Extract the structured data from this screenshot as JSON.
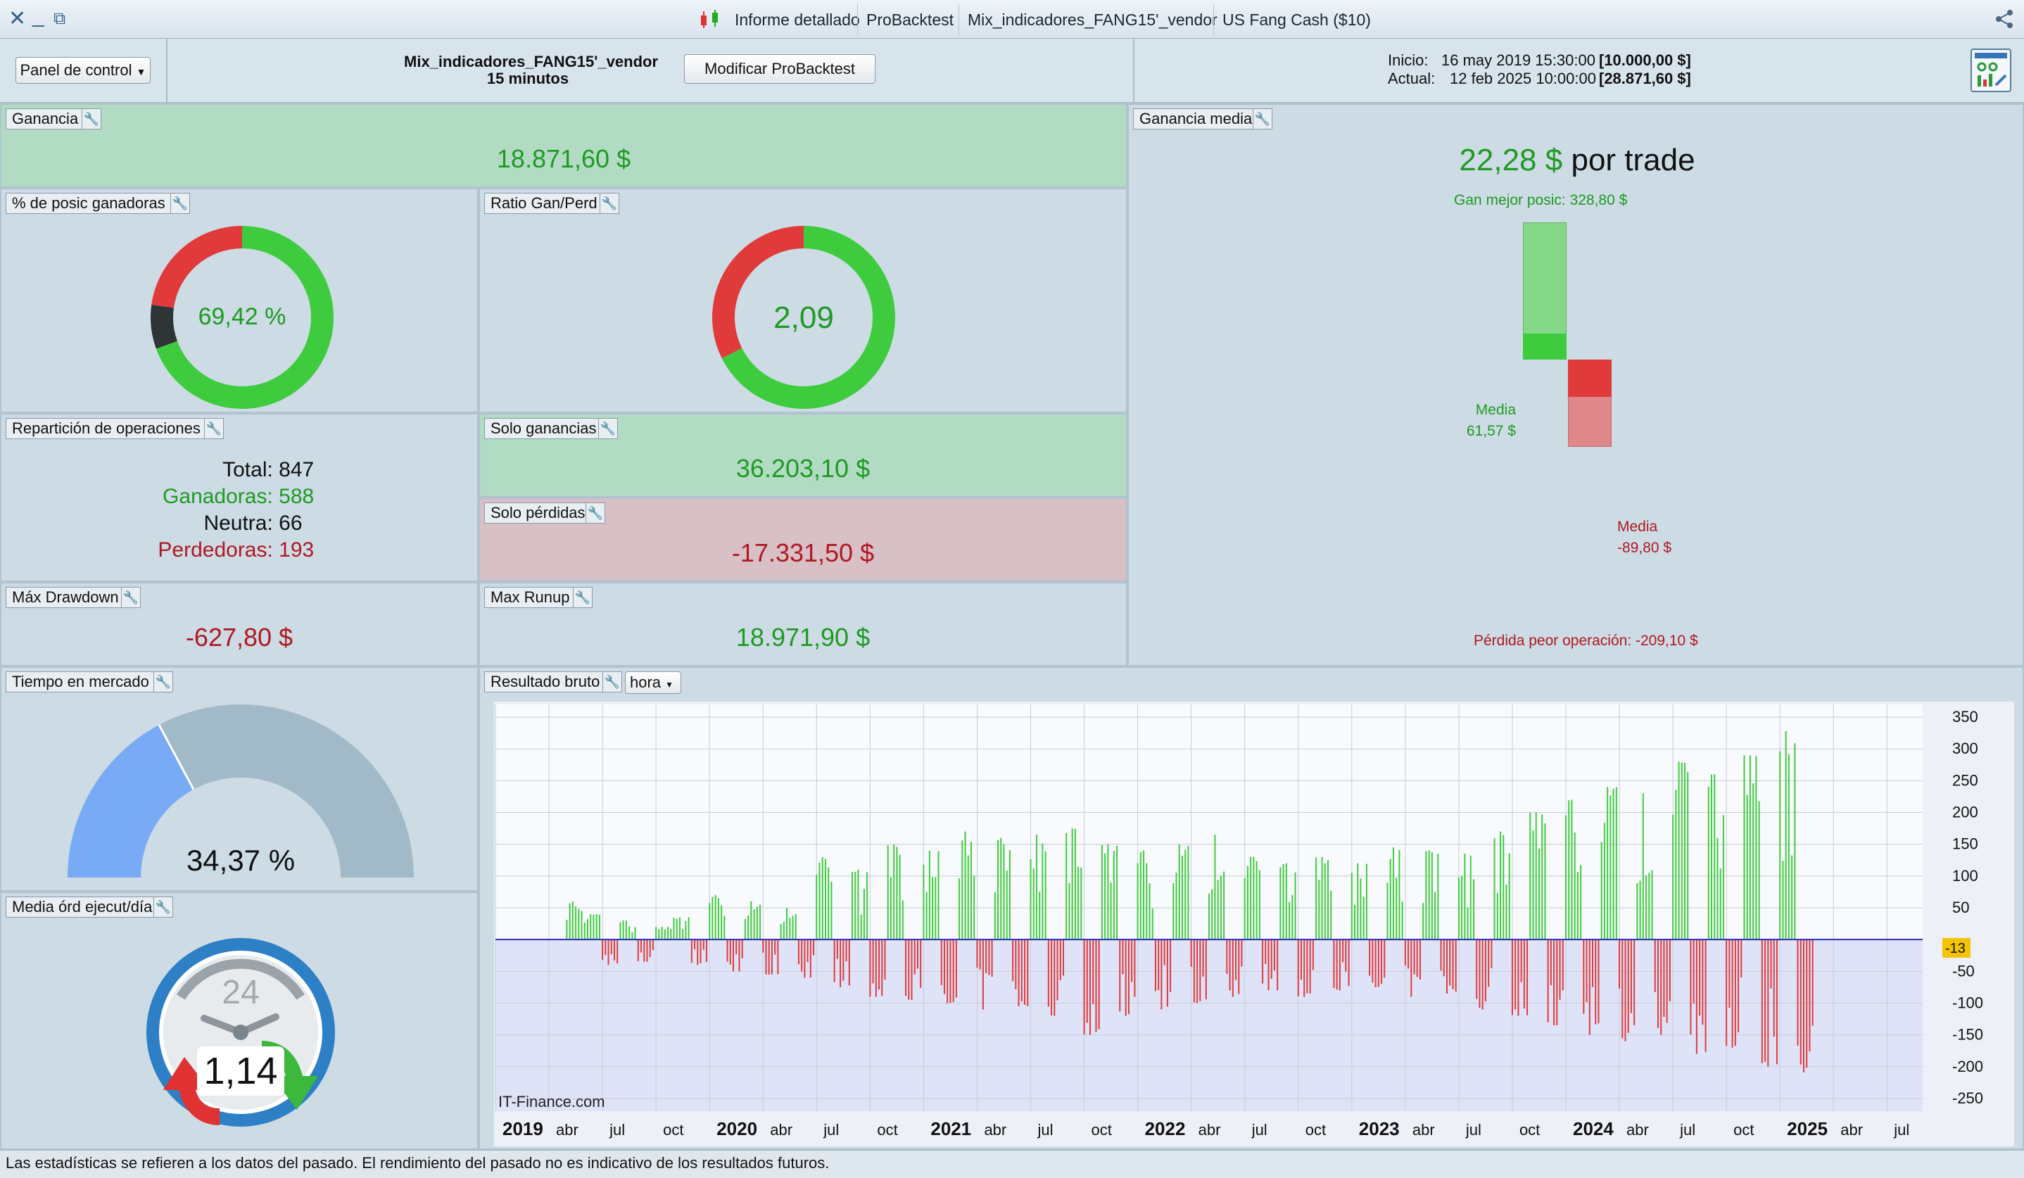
{
  "titlebar": {
    "tabs": [
      "Informe detallado",
      "ProBacktest",
      "Mix_indicadores_FANG15'_vendor",
      "US Fang Cash ($10)"
    ],
    "close_icon": "close-icon",
    "minimize_icon": "minimize-icon",
    "restore_icon": "restore-icon",
    "share_icon": "share-icon"
  },
  "header": {
    "panel_menu_label": "Panel de control",
    "strategy_name": "Mix_indicadores_FANG15'_vendor",
    "timeframe": "15 minutos",
    "modify_button": "Modificar ProBacktest",
    "start_label": "Inicio:",
    "start_date": "16 may 2019 15:30:00",
    "start_value": "[10.000,00 $]",
    "current_label": "Actual:",
    "current_date": "12 feb 2025 10:00:00",
    "current_value": "[28.871,60 $]"
  },
  "ganancia": {
    "label": "Ganancia",
    "value": "18.871,60 $"
  },
  "winners_pct": {
    "label": "% de posic ganadoras",
    "value": "69,42 %",
    "win": 588,
    "neutral": 66,
    "lose": 193
  },
  "ratio": {
    "label": "Ratio Gan/Perd",
    "value": "2,09",
    "gain": 36203.1,
    "loss": 17331.5
  },
  "reparticion": {
    "label": "Repartición de operaciones",
    "total_label": "Total:",
    "total": "847",
    "win_label": "Ganadoras:",
    "win": "588",
    "neutral_label": "Neutra:",
    "neutral": "66",
    "lose_label": "Perdedoras:",
    "lose": "193"
  },
  "solo_ganancias": {
    "label": "Solo ganancias",
    "value": "36.203,10 $"
  },
  "solo_perdidas": {
    "label": "Solo pérdidas",
    "value": "-17.331,50 $"
  },
  "max_drawdown": {
    "label": "Máx Drawdown",
    "value": "-627,80 $"
  },
  "max_runup": {
    "label": "Max Runup",
    "value": "18.971,90 $"
  },
  "ganancia_media": {
    "label": "Ganancia media",
    "value": "22,28 $",
    "suffix": "por trade",
    "best_label": "Gan mejor posic: 328,80 $",
    "best": 328.8,
    "avg_win_label": "Media",
    "avg_win_value": "61,57 $",
    "avg_win": 61.57,
    "avg_loss_label": "Media",
    "avg_loss_value": "-89,80 $",
    "avg_loss": -89.8,
    "worst_label": "Pérdida peor operación: -209,10 $",
    "worst": -209.1
  },
  "tiempo_mercado": {
    "label": "Tiempo en mercado",
    "value": "34,37 %",
    "fraction": 0.3437
  },
  "media_ord": {
    "label": "Media órd ejecut/día",
    "value": "1,14",
    "clock_text": "24"
  },
  "resultado_bruto": {
    "label": "Resultado bruto",
    "dropdown": "hora",
    "watermark": "IT-Finance.com",
    "last_value_label": "-13"
  },
  "chart_data": {
    "type": "bar",
    "title": "",
    "ylim": [
      -270,
      370
    ],
    "y_ticks": [
      350,
      300,
      250,
      200,
      150,
      100,
      50,
      -50,
      -100,
      -150,
      -200,
      -250
    ],
    "x_ticks": [
      {
        "label": "2019",
        "bold": true,
        "date": "2019-01"
      },
      {
        "label": "abr",
        "bold": false,
        "date": "2019-04"
      },
      {
        "label": "jul",
        "bold": false,
        "date": "2019-07"
      },
      {
        "label": "oct",
        "bold": false,
        "date": "2019-10"
      },
      {
        "label": "2020",
        "bold": true,
        "date": "2020-01"
      },
      {
        "label": "abr",
        "bold": false,
        "date": "2020-04"
      },
      {
        "label": "jul",
        "bold": false,
        "date": "2020-07"
      },
      {
        "label": "oct",
        "bold": false,
        "date": "2020-10"
      },
      {
        "label": "2021",
        "bold": true,
        "date": "2021-01"
      },
      {
        "label": "abr",
        "bold": false,
        "date": "2021-04"
      },
      {
        "label": "jul",
        "bold": false,
        "date": "2021-07"
      },
      {
        "label": "oct",
        "bold": false,
        "date": "2021-10"
      },
      {
        "label": "2022",
        "bold": true,
        "date": "2022-01"
      },
      {
        "label": "abr",
        "bold": false,
        "date": "2022-04"
      },
      {
        "label": "jul",
        "bold": false,
        "date": "2022-07"
      },
      {
        "label": "oct",
        "bold": false,
        "date": "2022-10"
      },
      {
        "label": "2023",
        "bold": true,
        "date": "2023-01"
      },
      {
        "label": "abr",
        "bold": false,
        "date": "2023-04"
      },
      {
        "label": "jul",
        "bold": false,
        "date": "2023-07"
      },
      {
        "label": "oct",
        "bold": false,
        "date": "2023-10"
      },
      {
        "label": "2024",
        "bold": true,
        "date": "2024-01"
      },
      {
        "label": "abr",
        "bold": false,
        "date": "2024-04"
      },
      {
        "label": "jul",
        "bold": false,
        "date": "2024-07"
      },
      {
        "label": "oct",
        "bold": false,
        "date": "2024-10"
      },
      {
        "label": "2025",
        "bold": true,
        "date": "2025-01"
      },
      {
        "label": "abr",
        "bold": false,
        "date": "2025-04"
      },
      {
        "label": "jul",
        "bold": false,
        "date": "2025-07"
      }
    ],
    "series": [
      {
        "values": [
          {
            "date": "2019-05",
            "v": 60
          },
          {
            "date": "2019-06",
            "v": 40
          },
          {
            "date": "2019-07",
            "v": -40
          },
          {
            "date": "2019-08",
            "v": 30
          },
          {
            "date": "2019-09",
            "v": -35
          },
          {
            "date": "2019-10",
            "v": 20
          },
          {
            "date": "2019-11",
            "v": 35
          },
          {
            "date": "2019-12",
            "v": -40
          },
          {
            "date": "2020-01",
            "v": 70
          },
          {
            "date": "2020-02",
            "v": -50
          },
          {
            "date": "2020-03",
            "v": 60
          },
          {
            "date": "2020-04",
            "v": -55
          },
          {
            "date": "2020-05",
            "v": 50
          },
          {
            "date": "2020-06",
            "v": -60
          },
          {
            "date": "2020-07",
            "v": 130
          },
          {
            "date": "2020-08",
            "v": -75
          },
          {
            "date": "2020-09",
            "v": 110
          },
          {
            "date": "2020-10",
            "v": -90
          },
          {
            "date": "2020-11",
            "v": 150
          },
          {
            "date": "2020-12",
            "v": -95
          },
          {
            "date": "2021-01",
            "v": 140
          },
          {
            "date": "2021-02",
            "v": -100
          },
          {
            "date": "2021-03",
            "v": 170
          },
          {
            "date": "2021-04",
            "v": -110
          },
          {
            "date": "2021-05",
            "v": 160
          },
          {
            "date": "2021-06",
            "v": -105
          },
          {
            "date": "2021-07",
            "v": 165
          },
          {
            "date": "2021-08",
            "v": -120
          },
          {
            "date": "2021-09",
            "v": 175
          },
          {
            "date": "2021-10",
            "v": -150
          },
          {
            "date": "2021-11",
            "v": 150
          },
          {
            "date": "2021-12",
            "v": -120
          },
          {
            "date": "2022-01",
            "v": 140
          },
          {
            "date": "2022-02",
            "v": -110
          },
          {
            "date": "2022-03",
            "v": 150
          },
          {
            "date": "2022-04",
            "v": -100
          },
          {
            "date": "2022-05",
            "v": 165
          },
          {
            "date": "2022-06",
            "v": -90
          },
          {
            "date": "2022-07",
            "v": 130
          },
          {
            "date": "2022-08",
            "v": -80
          },
          {
            "date": "2022-09",
            "v": 120
          },
          {
            "date": "2022-10",
            "v": -90
          },
          {
            "date": "2022-11",
            "v": 130
          },
          {
            "date": "2022-12",
            "v": -80
          },
          {
            "date": "2023-01",
            "v": 120
          },
          {
            "date": "2023-02",
            "v": -75
          },
          {
            "date": "2023-03",
            "v": 145
          },
          {
            "date": "2023-04",
            "v": -90
          },
          {
            "date": "2023-05",
            "v": 140
          },
          {
            "date": "2023-06",
            "v": -85
          },
          {
            "date": "2023-07",
            "v": 135
          },
          {
            "date": "2023-08",
            "v": -110
          },
          {
            "date": "2023-09",
            "v": 170
          },
          {
            "date": "2023-10",
            "v": -120
          },
          {
            "date": "2023-11",
            "v": 200
          },
          {
            "date": "2023-12",
            "v": -135
          },
          {
            "date": "2024-01",
            "v": 220
          },
          {
            "date": "2024-02",
            "v": -150
          },
          {
            "date": "2024-03",
            "v": 240
          },
          {
            "date": "2024-04",
            "v": -160
          },
          {
            "date": "2024-05",
            "v": 230
          },
          {
            "date": "2024-06",
            "v": -150
          },
          {
            "date": "2024-07",
            "v": 280
          },
          {
            "date": "2024-08",
            "v": -180
          },
          {
            "date": "2024-09",
            "v": 260
          },
          {
            "date": "2024-10",
            "v": -170
          },
          {
            "date": "2024-11",
            "v": 290
          },
          {
            "date": "2024-12",
            "v": -200
          },
          {
            "date": "2025-01",
            "v": 328
          },
          {
            "date": "2025-02",
            "v": -209
          }
        ]
      }
    ]
  },
  "footer": {
    "text": "Las estadísticas se refieren a los datos del pasado. El rendimiento del pasado no es indicativo de los resultados futuros."
  },
  "colors": {
    "green": "#3ecc3e",
    "red": "#e03a3a",
    "dark": "#2f3437",
    "gauge_blue": "#78aaf5",
    "gauge_gray": "#a2bac8"
  }
}
